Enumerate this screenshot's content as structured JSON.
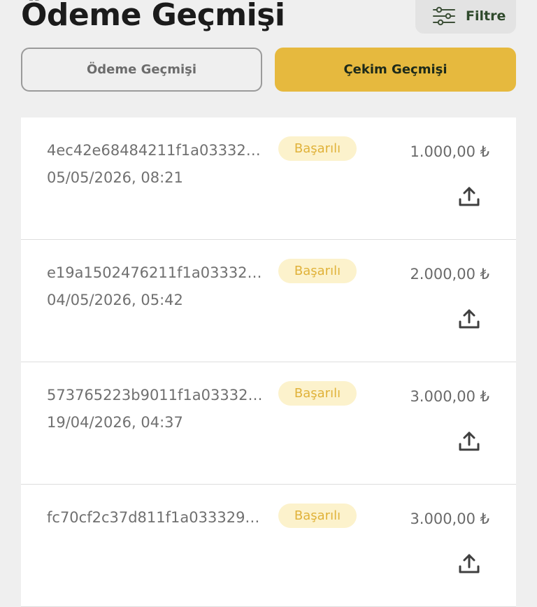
{
  "header": {
    "title": "Ödeme Geçmişi",
    "filter": {
      "label": "Filtre",
      "icon": "sliders-icon"
    }
  },
  "tabs": [
    {
      "label": "Ödeme Geçmişi",
      "active": false
    },
    {
      "label": "Çekim Geçmişi",
      "active": true
    }
  ],
  "colors": {
    "accent": "#e6b93e",
    "status_background": "#fcf2cc",
    "status_text": "#e0b23a",
    "background": "#efefef"
  },
  "transactions": [
    {
      "id": "4ec42e68484211f1a03332…",
      "date": "05/05/2026, 08:21",
      "status": "Başarılı",
      "amount": "1.000,00 ₺",
      "action_icon": "share-upload-icon"
    },
    {
      "id": "e19a1502476211f1a03332…",
      "date": "04/05/2026, 05:42",
      "status": "Başarılı",
      "amount": "2.000,00 ₺",
      "action_icon": "share-upload-icon"
    },
    {
      "id": "573765223b9011f1a03332…",
      "date": "19/04/2026, 04:37",
      "status": "Başarılı",
      "amount": "3.000,00 ₺",
      "action_icon": "share-upload-icon"
    },
    {
      "id": "fc70cf2c37d811f1a033329…",
      "date": "",
      "status": "Başarılı",
      "amount": "3.000,00 ₺",
      "action_icon": "share-upload-icon"
    }
  ]
}
